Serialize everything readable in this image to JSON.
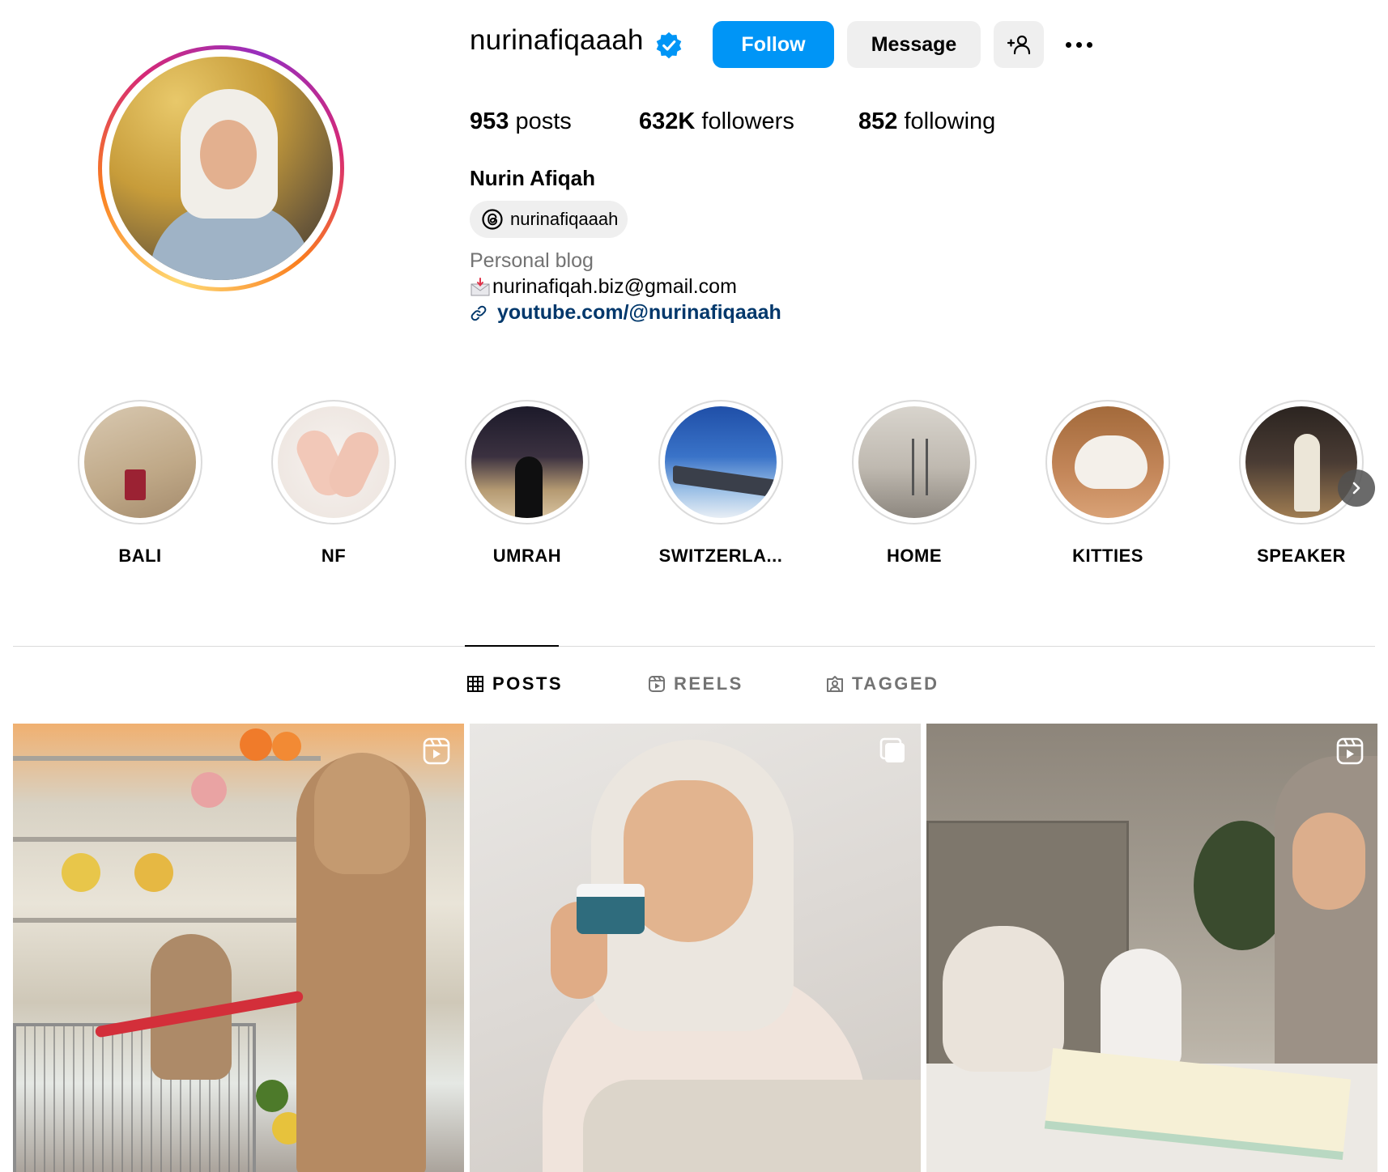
{
  "profile": {
    "username": "nurinafiqaaah",
    "verified": true,
    "full_name": "Nurin Afiqah",
    "threads_handle": "nurinafiqaaah",
    "category": "Personal blog",
    "email_line": "nurinafiqah.biz@gmail.com",
    "link": "youtube.com/@nurinafiqaaah"
  },
  "actions": {
    "follow_label": "Follow",
    "message_label": "Message",
    "add_user_icon": "person-add-icon",
    "more_icon": "more-options-icon"
  },
  "stats": {
    "posts_count": "953",
    "posts_label": " posts",
    "followers_count": "632K",
    "followers_label": " followers",
    "following_count": "852",
    "following_label": " following"
  },
  "highlights": [
    {
      "label": "BALI"
    },
    {
      "label": "NF"
    },
    {
      "label": "UMRAH"
    },
    {
      "label": "SWITZERLA..."
    },
    {
      "label": "HOME"
    },
    {
      "label": "KITTIES"
    },
    {
      "label": "SPEAKER"
    }
  ],
  "tabs": [
    {
      "label": "POSTS",
      "active": true,
      "icon": "grid-icon"
    },
    {
      "label": "REELS",
      "active": false,
      "icon": "reels-icon"
    },
    {
      "label": "TAGGED",
      "active": false,
      "icon": "tagged-icon"
    }
  ],
  "posts": [
    {
      "type": "reel",
      "badge_icon": "reel-badge-icon"
    },
    {
      "type": "carousel",
      "badge_icon": "carousel-badge-icon"
    },
    {
      "type": "reel",
      "badge_icon": "reel-badge-icon"
    }
  ],
  "colors": {
    "follow_button": "#0095f6",
    "link_text": "#00376b",
    "secondary_text": "#737373",
    "button_gray": "#efefef"
  }
}
